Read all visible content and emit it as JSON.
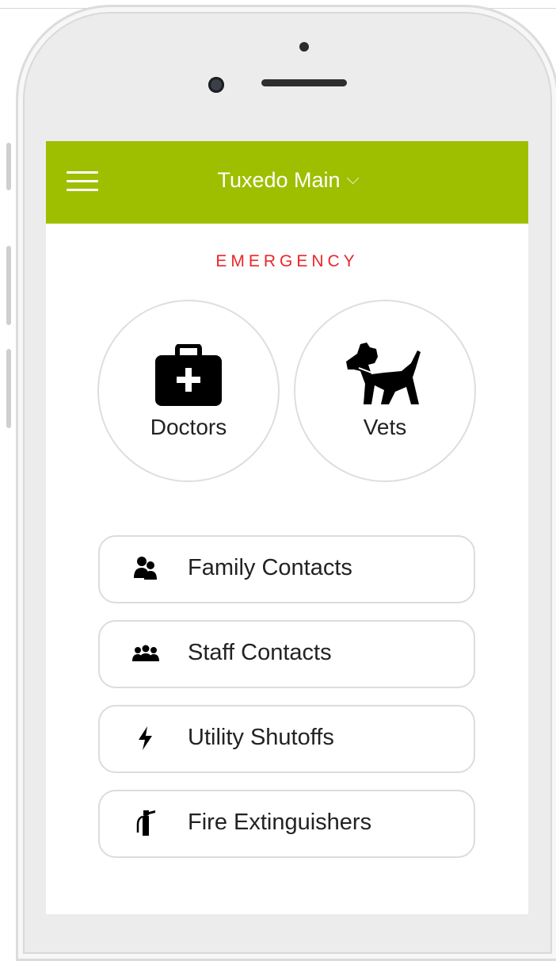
{
  "header": {
    "title": "Tuxedo Main",
    "color": "#9dbf00"
  },
  "section_label": "EMERGENCY",
  "emergency_buttons": [
    {
      "label": "Doctors",
      "icon": "medical-kit-icon"
    },
    {
      "label": "Vets",
      "icon": "dog-icon"
    }
  ],
  "contacts": [
    {
      "label": "Family Contacts",
      "icon": "family-icon"
    },
    {
      "label": "Staff Contacts",
      "icon": "staff-icon"
    },
    {
      "label": "Utility Shutoffs",
      "icon": "lightning-icon"
    },
    {
      "label": "Fire Extinguishers",
      "icon": "fire-extinguisher-icon"
    }
  ],
  "colors": {
    "accent": "#9dbf00",
    "emergency": "#e8262b"
  }
}
